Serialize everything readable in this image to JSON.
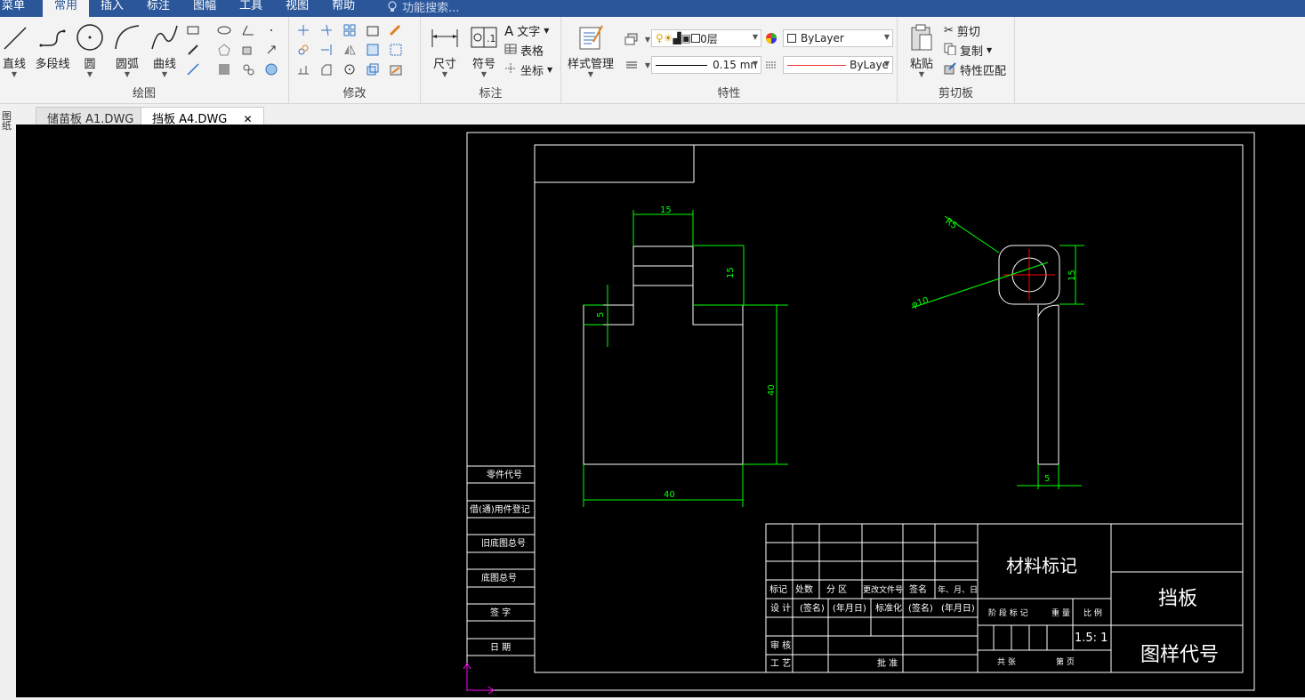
{
  "menu": {
    "items": [
      "菜单",
      "常用",
      "插入",
      "标注",
      "图幅",
      "工具",
      "视图",
      "帮助"
    ],
    "search_placeholder": "功能搜索..."
  },
  "ribbon": {
    "draw": {
      "title": "绘图",
      "line": "直线",
      "polyline": "多段线",
      "circle": "圆",
      "arc": "圆弧",
      "curve": "曲线"
    },
    "modify": {
      "title": "修改"
    },
    "annotate": {
      "title": "标注",
      "dimension": "尺寸",
      "symbol": "符号",
      "text": "文字",
      "table": "表格",
      "coordinate": "坐标"
    },
    "properties": {
      "title": "特性",
      "style_manager": "样式管理",
      "layer": "0层",
      "color": "ByLayer",
      "lineweight": "0.15 mn",
      "linetype": "ByLaye"
    },
    "clipboard": {
      "title": "剪切板",
      "paste": "粘贴",
      "cut": "剪切",
      "copy": "复制",
      "match": "特性匹配"
    }
  },
  "tabs": [
    {
      "label": "储苗板 A1.DWG",
      "active": false
    },
    {
      "label": "挡板 A4.DWG",
      "active": true
    }
  ],
  "left_strip": "图纸",
  "drawing": {
    "dims": {
      "top_width": "15",
      "top_height": "15",
      "step": "5",
      "body_height": "40",
      "body_width": "40",
      "radius": "R5",
      "diameter": "φ10",
      "side_height": "15",
      "side_width": "5"
    },
    "side_table": [
      "零件代号",
      "借(通)用件登记",
      "旧底图总号",
      "底图总号",
      "签  字",
      "日  期"
    ],
    "title_block": {
      "material": "材料标记",
      "part_name": "挡板",
      "drawing_no": "图样代号",
      "scale": "1.5: 1",
      "headers": [
        "标记",
        "处数",
        "分  区",
        "更改文件号",
        "签名",
        "年、月、日"
      ],
      "row_design": [
        "设  计",
        "(签名)",
        "(年月日)",
        "标准化",
        "(签名)",
        "(年月日)"
      ],
      "review": "审  核",
      "process": "工  艺",
      "approve": "批  准",
      "stage_labels": [
        "阶  段  标  记",
        "重  量",
        "比  例"
      ],
      "sheet_labels": [
        "共    张",
        "第    页"
      ]
    }
  },
  "colors": {
    "menubar": "#2b579a",
    "dimension": "#00ff00",
    "center": "#ff0000",
    "ucs": "#ff00ff"
  }
}
